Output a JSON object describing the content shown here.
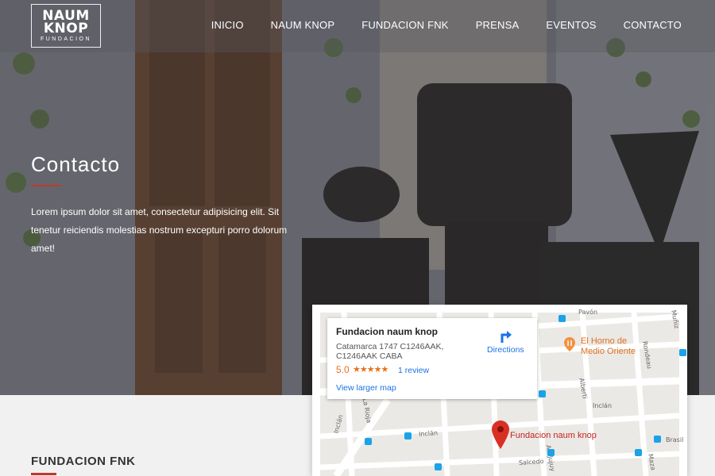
{
  "header": {
    "logo": {
      "line1": "NAUM",
      "line2": "KNOP",
      "sub": "FUNDACION"
    },
    "nav": [
      "INICIO",
      "NAUM KNOP",
      "FUNDACION FNK",
      "PRENSA",
      "EVENTOS",
      "CONTACTO"
    ]
  },
  "hero": {
    "title": "Contacto",
    "text": "Lorem ipsum dolor sit amet, consectetur adipisicing elit. Sit tenetur reiciendis molestias nostrum excepturi porro dolorum amet!"
  },
  "section": {
    "title": "FUNDACION FNK"
  },
  "map": {
    "place_name": "Fundacion naum knop",
    "address": "Catamarca 1747 C1246AAK, C1246AAK CABA",
    "rating": "5.0",
    "stars": "★★★★★",
    "reviews": "1 review",
    "larger_map": "View larger map",
    "directions": "Directions",
    "pin_label": "Fundacion naum knop",
    "poi": "El Horno de Medio Oriente",
    "streets": [
      "Pavón",
      "Inclán",
      "Inclán",
      "Inclán",
      "Salcedo",
      "Alberti",
      "La Rioja",
      "Av. Jujuy",
      "Brasil",
      "Maza",
      "Rondeau",
      "Muñiz"
    ]
  },
  "colors": {
    "accent": "#c0392b",
    "link": "#1a73e8",
    "rating": "#e7711b"
  }
}
